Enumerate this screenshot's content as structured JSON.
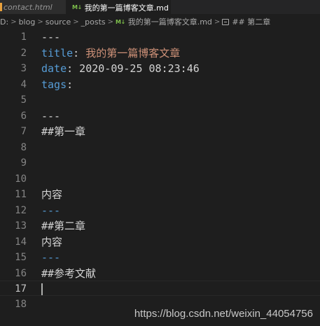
{
  "tabs": [
    {
      "label": "contact.html",
      "active": false,
      "icon": "html-file-icon"
    },
    {
      "label": "我的第一篇博客文章.md",
      "active": true,
      "icon": "markdown-file-icon",
      "icon_text": "M↓"
    }
  ],
  "breadcrumb": {
    "items": [
      "D:",
      "blog",
      "source",
      "_posts",
      "我的第一篇博客文章.md",
      "## 第二章"
    ],
    "separator": ">",
    "md_icon_text": "M↓"
  },
  "editor": {
    "current_line": 17,
    "lines": [
      {
        "n": "1",
        "text": "---"
      },
      {
        "n": "2",
        "key": "title",
        "colon": ":",
        "value": " 我的第一篇博客文章"
      },
      {
        "n": "3",
        "key": "date",
        "colon": ":",
        "value": " 2020-09-25 08:23:46"
      },
      {
        "n": "4",
        "key": "tags",
        "colon": ":",
        "value": ""
      },
      {
        "n": "5",
        "text": ""
      },
      {
        "n": "6",
        "text": "---"
      },
      {
        "n": "7",
        "text": "##第一章"
      },
      {
        "n": "8",
        "text": ""
      },
      {
        "n": "9",
        "text": ""
      },
      {
        "n": "10",
        "text": ""
      },
      {
        "n": "11",
        "text": "内容"
      },
      {
        "n": "12",
        "text": "---"
      },
      {
        "n": "13",
        "text": "##第二章"
      },
      {
        "n": "14",
        "text": "内容"
      },
      {
        "n": "15",
        "text": "---"
      },
      {
        "n": "16",
        "text": "##参考文献"
      },
      {
        "n": "17",
        "text": ""
      },
      {
        "n": "18",
        "text": ""
      }
    ]
  },
  "watermark": "https://blog.csdn.net/weixin_44054756",
  "colors": {
    "background": "#1e1e1e",
    "key_blue": "#569cd6",
    "string_orange": "#ce9178",
    "line_number": "#858585",
    "markdown_icon_green": "#7dbf4b"
  }
}
